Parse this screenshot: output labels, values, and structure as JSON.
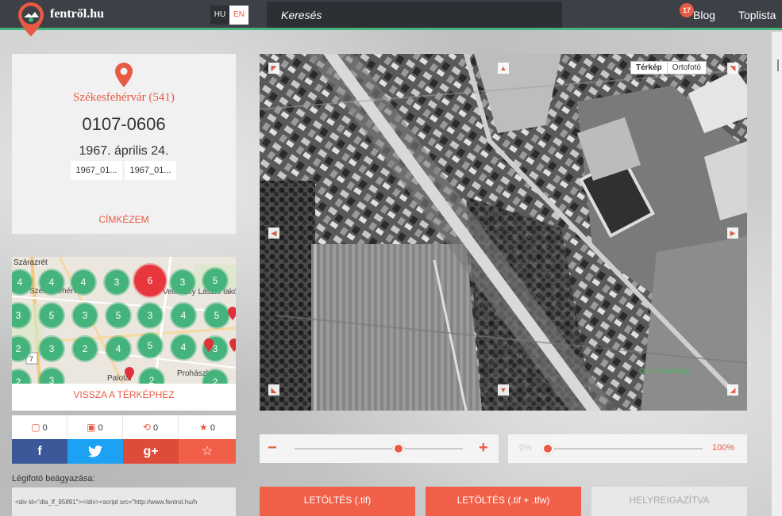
{
  "header": {
    "logo_text": "fentről.hu",
    "lang_hu": "HU",
    "lang_en": "EN",
    "search_label": "Keresés",
    "blog": "Blog",
    "blog_badge": "17",
    "toplista": "Toplista"
  },
  "photo_info": {
    "city": "Székesfehérvár (541)",
    "code": "0107-0606",
    "date": "1967. április 24.",
    "chips": [
      "1967_01...",
      "1967_01..."
    ],
    "tag_button": "CÍMKÉZEM"
  },
  "minimap": {
    "labels": [
      "Szárazrét",
      "Székesfehérvár",
      "Velinszky László lakótelep",
      "Palotai",
      "Prohászka"
    ],
    "clusters": [
      "4",
      "4",
      "4",
      "3",
      "6",
      "3",
      "5",
      "3",
      "5",
      "3",
      "5",
      "3",
      "4",
      "5",
      "2",
      "3",
      "2",
      "4",
      "5",
      "4",
      "3",
      "2",
      "3",
      "2",
      "2"
    ],
    "road_number": "7",
    "back_button": "VISSZA A TÉRKÉPHEZ"
  },
  "stats": {
    "comments": "0",
    "saves": "0",
    "shares": "0",
    "stars": "0"
  },
  "share": {
    "facebook": "f",
    "google": "g+"
  },
  "embed": {
    "label": "Légifotó beágyazása:",
    "code": "<div id=\"dla_lf_95891\"></div><script src=\"http://www.fentrol.hu/h"
  },
  "photo": {
    "toggle_map": "Térkép",
    "toggle_ortho": "Ortofotó",
    "attribution": "OpenStreetMap"
  },
  "zoom": {
    "minus": "−",
    "plus": "+",
    "value": 0.62
  },
  "opacity": {
    "min_label": "0%",
    "max_label": "100%",
    "value": 0.0
  },
  "buttons": {
    "download_tif": "LETÖLTÉS (.tif)",
    "download_tif_tfw": "LETÖLTÉS (.tif + .tfw)",
    "georeferenced": "HELYREIGAZÍTVA"
  },
  "colors": {
    "accent": "#e85a43",
    "header": "#3d4046",
    "green": "#45b37c",
    "facebook": "#3b5998",
    "twitter": "#1da1f2",
    "google": "#dd4b39",
    "star": "#f25f48"
  }
}
